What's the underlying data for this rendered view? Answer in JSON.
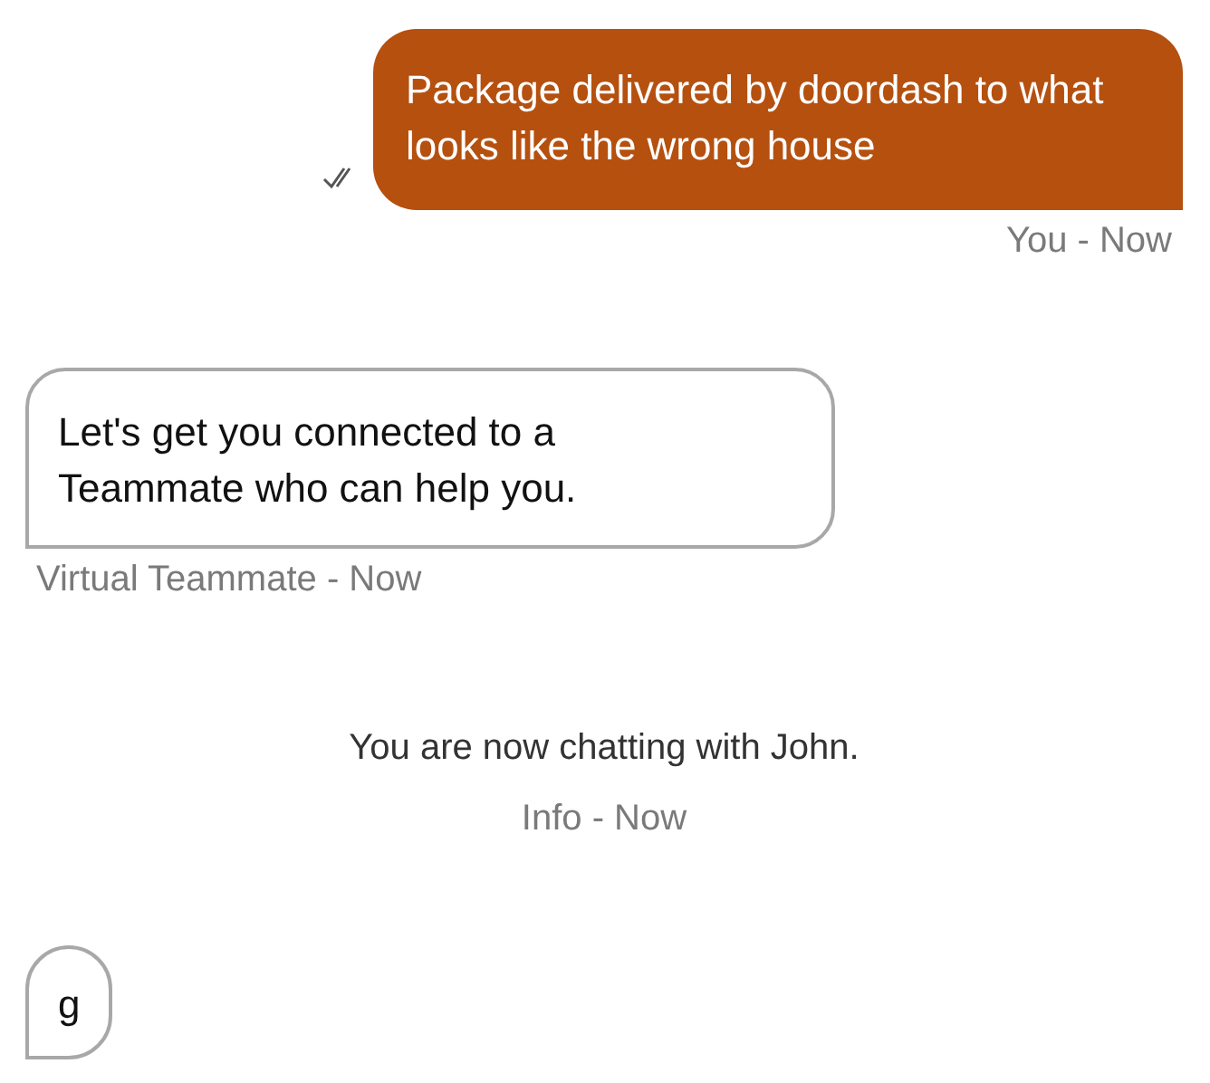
{
  "messages": [
    {
      "kind": "outgoing",
      "text": "Package delivered by doordash to what looks like the wrong house",
      "read": true,
      "meta": "You - Now"
    },
    {
      "kind": "incoming",
      "text": "Let's get you connected to a Teammate who can help you.",
      "meta": "Virtual Teammate - Now"
    },
    {
      "kind": "info",
      "text": "You are now chatting with John.",
      "meta": "Info - Now"
    },
    {
      "kind": "incoming",
      "text": "g"
    }
  ]
}
